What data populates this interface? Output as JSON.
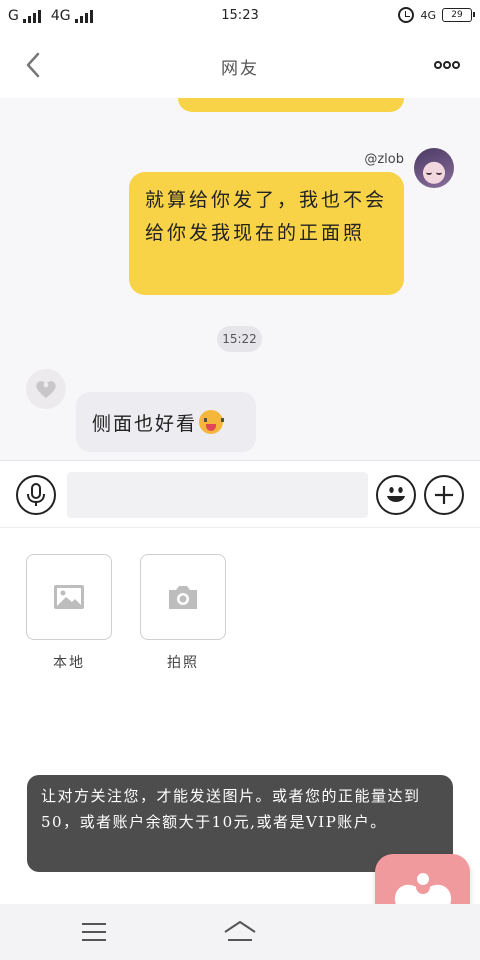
{
  "status_bar": {
    "carrier1": "G",
    "carrier2": "4G",
    "time": "15:23",
    "network_right": "4G",
    "battery": "29"
  },
  "header": {
    "title": "网友",
    "back_icon": "chevron-left-icon",
    "more_icon": "more-horizontal-icon"
  },
  "chat": {
    "my_handle": "@zlob",
    "messages": [
      {
        "from": "me",
        "text": "就算给你发了，我也不会给你发我现在的正面照"
      },
      {
        "from": "other",
        "text": "侧面也好看",
        "emoji": "tongue-out-emoji"
      }
    ],
    "time_separator": "15:22"
  },
  "input_bar": {
    "value": "",
    "placeholder": ""
  },
  "attach_panel": {
    "items": [
      {
        "label": "本地",
        "icon": "image-icon"
      },
      {
        "label": "拍照",
        "icon": "camera-icon"
      }
    ]
  },
  "toast": {
    "text": "让对方关注您，才能发送图片。或者您的正能量达到50，或者账户余额大于10元,或者是VIP账户。"
  },
  "colors": {
    "my_bubble": "#f8d348",
    "other_bubble": "#ececf1",
    "toast_bg": "#4d4d4d",
    "app_icon": "#f09a9e"
  }
}
